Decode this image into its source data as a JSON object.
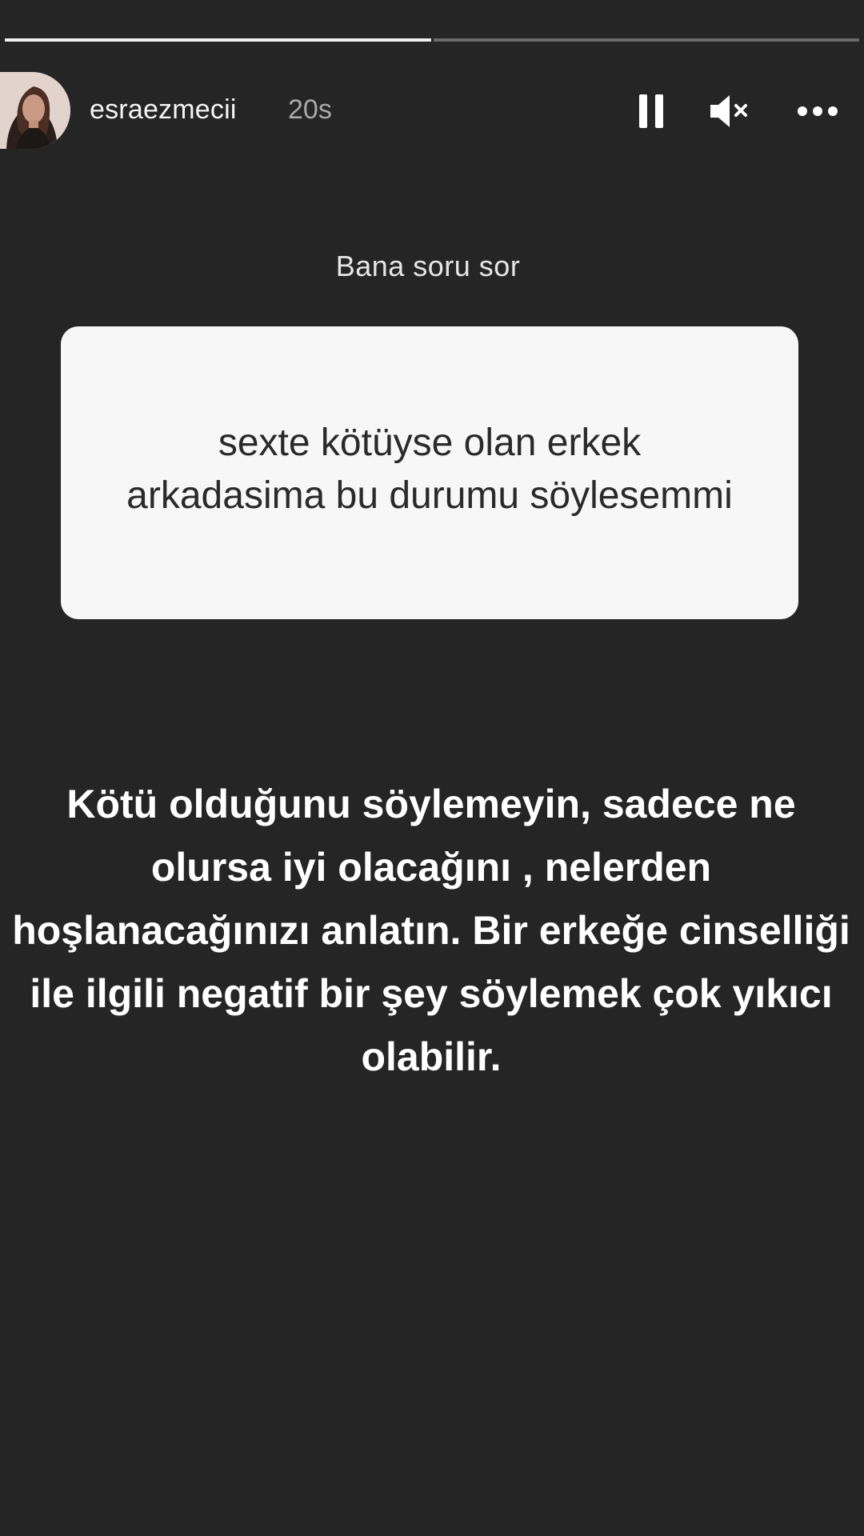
{
  "story": {
    "progress_total_segments": 2,
    "progress_completed_segments": 1
  },
  "header": {
    "username": "esraezmecii",
    "timestamp": "20s",
    "icons": {
      "pause": "pause-icon",
      "mute": "mute-icon",
      "more": "more-options-icon"
    }
  },
  "question_sticker": {
    "label": "Bana soru sor",
    "question": "sexte kötüyse olan erkek arkadasima bu durumu söylesemmi"
  },
  "answer": {
    "text": "Kötü olduğunu söylemeyin, sadece ne olursa iyi olacağını , nelerden hoşlanacağınızı anlatın. Bir erkeğe cinselliği ile ilgili negatif bir şey söylemek çok yıkıcı olabilir."
  },
  "colors": {
    "background": "#252526",
    "card": "#f7f7f7",
    "card_text": "#2a2a2a",
    "text": "#ffffff",
    "muted_text": "#a8a8a8"
  }
}
